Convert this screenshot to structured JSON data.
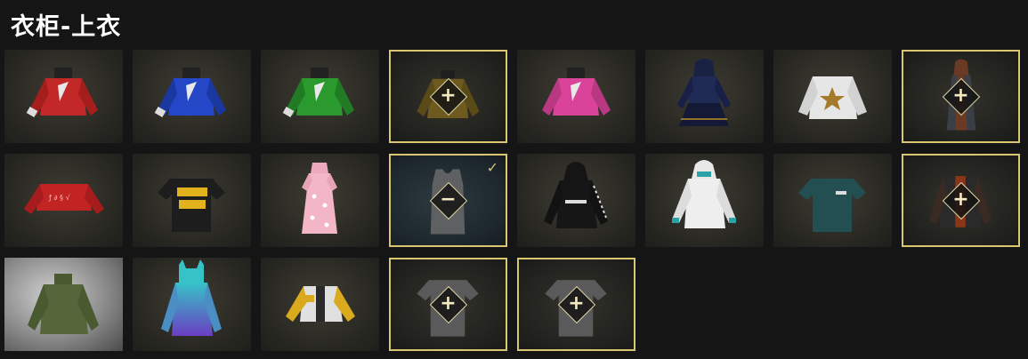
{
  "header": {
    "title": "衣柜-上衣"
  },
  "badge_glyphs": {
    "add": "+",
    "remove": "−",
    "check": "✓"
  },
  "colors": {
    "selected_border": "#d8c670",
    "background": "#151515"
  },
  "slots": [
    {
      "name": "red-long-sleeve-shirt",
      "row": 1,
      "col": 1,
      "state": "normal"
    },
    {
      "name": "blue-long-sleeve-shirt",
      "row": 1,
      "col": 2,
      "state": "normal"
    },
    {
      "name": "green-long-sleeve-shirt",
      "row": 1,
      "col": 3,
      "state": "normal"
    },
    {
      "name": "olive-top",
      "row": 1,
      "col": 4,
      "state": "selected-add"
    },
    {
      "name": "pink-long-sleeve-shirt",
      "row": 1,
      "col": 5,
      "state": "normal"
    },
    {
      "name": "navy-hooded-dress",
      "row": 1,
      "col": 6,
      "state": "normal"
    },
    {
      "name": "white-star-sweater",
      "row": 1,
      "col": 7,
      "state": "normal"
    },
    {
      "name": "hooded-cloak",
      "row": 1,
      "col": 8,
      "state": "selected-add"
    },
    {
      "name": "red-crop-top",
      "row": 2,
      "col": 1,
      "state": "normal"
    },
    {
      "name": "black-graphic-tshirt",
      "row": 2,
      "col": 2,
      "state": "normal"
    },
    {
      "name": "pink-cheongsam",
      "row": 2,
      "col": 3,
      "state": "normal"
    },
    {
      "name": "gray-tank-top",
      "row": 2,
      "col": 4,
      "state": "equipped"
    },
    {
      "name": "black-hoodie",
      "row": 2,
      "col": 5,
      "state": "normal"
    },
    {
      "name": "white-hoodie",
      "row": 2,
      "col": 6,
      "state": "normal"
    },
    {
      "name": "teal-tshirt",
      "row": 2,
      "col": 7,
      "state": "normal"
    },
    {
      "name": "leather-jacket",
      "row": 2,
      "col": 8,
      "state": "selected-add"
    },
    {
      "name": "green-turtleneck",
      "row": 3,
      "col": 1,
      "state": "normal"
    },
    {
      "name": "teal-purple-hoodie",
      "row": 3,
      "col": 2,
      "state": "normal"
    },
    {
      "name": "yellow-white-jacket",
      "row": 3,
      "col": 3,
      "state": "normal"
    },
    {
      "name": "gray-tshirt",
      "row": 3,
      "col": 4,
      "state": "selected-add"
    },
    {
      "name": "gray-tshirt-2",
      "row": 3,
      "col": 5,
      "state": "selected-add"
    }
  ]
}
